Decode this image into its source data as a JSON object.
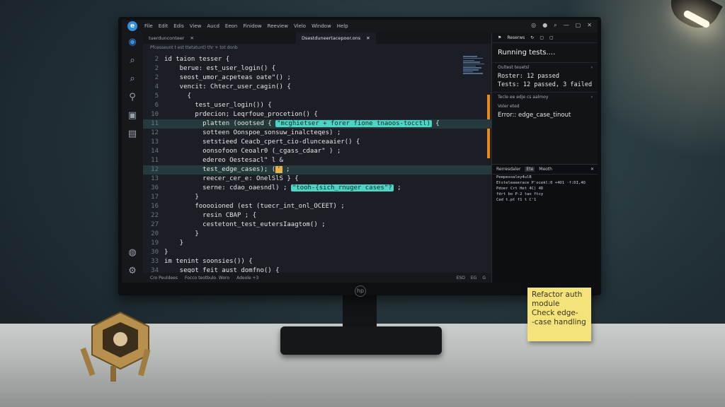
{
  "titlebar": {
    "menu": [
      "File",
      "Edit",
      "Edis",
      "View",
      "Aucd",
      "Eeon",
      "Finidow",
      "Reeview",
      "Vielo",
      "Window",
      "Help"
    ]
  },
  "tabs": [
    {
      "label": "tuerdunconteer"
    },
    {
      "label": "Dsestduneertacepoor.ons"
    }
  ],
  "breadcrumb": "Pfcesseunt t est ttetatunt) thr + tot donb",
  "code_lines": [
    {
      "n": "2",
      "text": "id taion tesser {"
    },
    {
      "n": "2",
      "text": "    berue: est_user_login() {"
    },
    {
      "n": "2",
      "text": "    seost_umor_acpeteas oate\"() ;"
    },
    {
      "n": "4",
      "text": "    vencit: Chtecr_user_cagin() {"
    },
    {
      "n": "5",
      "text": "      {"
    },
    {
      "n": "6",
      "text": "        test_user_login()) {"
    },
    {
      "n": "10",
      "text": "        prdecion; Leqrfoue_procetion() {"
    },
    {
      "n": "11",
      "text": "          platten (oootsed { ",
      "chip": "\"mcghietser + forer fione tnaoos-tocctl)",
      "after": " {"
    },
    {
      "n": "12",
      "text": "          sotteen Oonspoe_sonsuw_inalcteqes) ;"
    },
    {
      "n": "13",
      "text": "          setstieed Ceacb_cpert_cio-dlunceaaier() {"
    },
    {
      "n": "14",
      "text": "          oonsofoon Ceoalr0 (_cgass_cdaar\" ) ;"
    },
    {
      "n": "11",
      "text": "          edereo Oestesacl\" l &"
    },
    {
      "n": "12",
      "text": "          test_edge_cases); (",
      "chip_y": "'",
      "after": " ;"
    },
    {
      "n": "13",
      "text": "          reecer_cer_e: OnelSlS } {"
    },
    {
      "n": "36",
      "text": "          serne: cdao_oaesndl) ; ",
      "chip": "\"tooh-{sich_rnuger cases\"?",
      "after": " ;"
    },
    {
      "n": "17",
      "text": "        }"
    },
    {
      "n": "16",
      "text": "        fooooioned (est (tuecr_int_onl_OCEET) ;"
    },
    {
      "n": "22",
      "text": "          resin CBAP ; {"
    },
    {
      "n": "27",
      "text": "          cestetont_test_eutersIaagtom() ;"
    },
    {
      "n": "20",
      "text": "        }"
    },
    {
      "n": "19",
      "text": "    }"
    },
    {
      "n": "30",
      "text": "}"
    },
    {
      "n": "33",
      "text": "im tenint soonsies()) {"
    },
    {
      "n": "34",
      "text": "    segot feit_aust_domfno() {"
    }
  ],
  "statusbar": {
    "left": [
      "Cro Peuldees",
      "Focco teotbulo. Woro",
      "Adeole +3"
    ],
    "right": [
      "ESO",
      "EG",
      "G"
    ]
  },
  "panel": {
    "header": "Reserws",
    "running": "Running tests....",
    "section1": "Oultest teuetsl",
    "result1_label": "Roster:",
    "result1_value": "12 passed",
    "result2_label": "Tests:",
    "result2_value": "12 passed, 3 failed",
    "section2": "Tecle ee edje cs aalmoy",
    "section3": "Voler eted",
    "error_label": "Error::",
    "error_value": "edge_case_tinout"
  },
  "terminal": {
    "tabs": [
      "Rerresdaler",
      "Ete",
      "Meoth"
    ],
    "lines": [
      "Peepesoaley4ulB",
      "Etsteleaeerace P'ocekl:0 +4O1 ·f:DI,4O",
      "Pdoer Crt Het 4C) 4D",
      "fdrt bo P-2 tao ftcy",
      "Cad t.pt f1 t C'1"
    ]
  },
  "sticky_note": [
    "Refactor auth",
    "module",
    "Check edge-",
    "-case handling"
  ],
  "colors": {
    "editor_bg": "#1b1e24",
    "chip_teal": "#4fd3c2",
    "chip_amber": "#e8b14a",
    "scroll_accent": "#e88a1a",
    "sticky": "#f3e37a"
  }
}
